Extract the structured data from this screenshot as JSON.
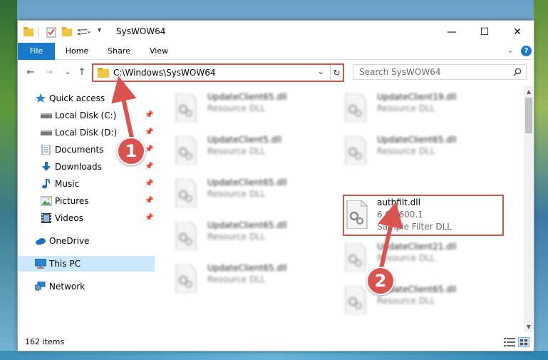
{
  "window": {
    "title": "SysWOW64",
    "minimize": "—",
    "maximize": "☐",
    "close": "✕"
  },
  "ribbon": {
    "tabs": [
      {
        "label": "File"
      },
      {
        "label": "Home"
      },
      {
        "label": "Share"
      },
      {
        "label": "View"
      }
    ],
    "collapse": "⌄",
    "help": "?"
  },
  "nav": {
    "back": "←",
    "forward": "→",
    "recent": "⌄",
    "up": "↑",
    "address": "C:\\Windows\\SysWOW64",
    "address_dropdown": "⌄",
    "refresh": "↻",
    "search_placeholder": "Search SysWOW64"
  },
  "sidebar": {
    "items": [
      {
        "label": "Quick access",
        "icon": "star-icon"
      },
      {
        "label": "Local Disk (C:)",
        "icon": "drive-icon",
        "pinned": true
      },
      {
        "label": "Local Disk (D:)",
        "icon": "drive-icon",
        "pinned": true
      },
      {
        "label": "Documents",
        "icon": "documents-icon",
        "pinned": true
      },
      {
        "label": "Downloads",
        "icon": "download-icon",
        "pinned": true
      },
      {
        "label": "Music",
        "icon": "music-icon",
        "pinned": true
      },
      {
        "label": "Pictures",
        "icon": "pictures-icon",
        "pinned": true
      },
      {
        "label": "Videos",
        "icon": "video-icon",
        "pinned": true
      },
      {
        "label": "OneDrive",
        "icon": "cloud-icon"
      },
      {
        "label": "This PC",
        "icon": "computer-icon",
        "selected": true
      },
      {
        "label": "Network",
        "icon": "network-icon"
      }
    ]
  },
  "files": {
    "col1": [
      {
        "name": "UpdateClient65.dll",
        "type": "Resource DLL"
      },
      {
        "name": "UpdateClient5.dll",
        "type": "Resource DLL"
      },
      {
        "name": "UpdateClient65.dll",
        "type": "Resource DLL"
      },
      {
        "name": "UpdateClient65.dll",
        "type": "Resource DLL"
      },
      {
        "name": "UpdateClient65.dll",
        "type": "Resource DLL"
      }
    ],
    "col2": [
      {
        "name": "UpdateClient19.dll",
        "type": "Resource DLL"
      },
      {
        "name": "UpdateClient65.dll",
        "type": "Resource DLL"
      },
      {
        "name": "UpdateClient21.dll",
        "type": "Resource DLL"
      },
      {
        "name": "UpdateClient65.dll",
        "type": "Resource DLL"
      }
    ],
    "highlighted": {
      "name": "authfilt.dll",
      "version": "6.0.2600.1",
      "description": "Sample Filter DLL"
    }
  },
  "status": {
    "count": "162 items"
  },
  "callouts": {
    "one": "1",
    "two": "2"
  },
  "colors": {
    "accent": "#1979ca",
    "highlight": "#d9534f",
    "selected": "#cce8ff"
  }
}
